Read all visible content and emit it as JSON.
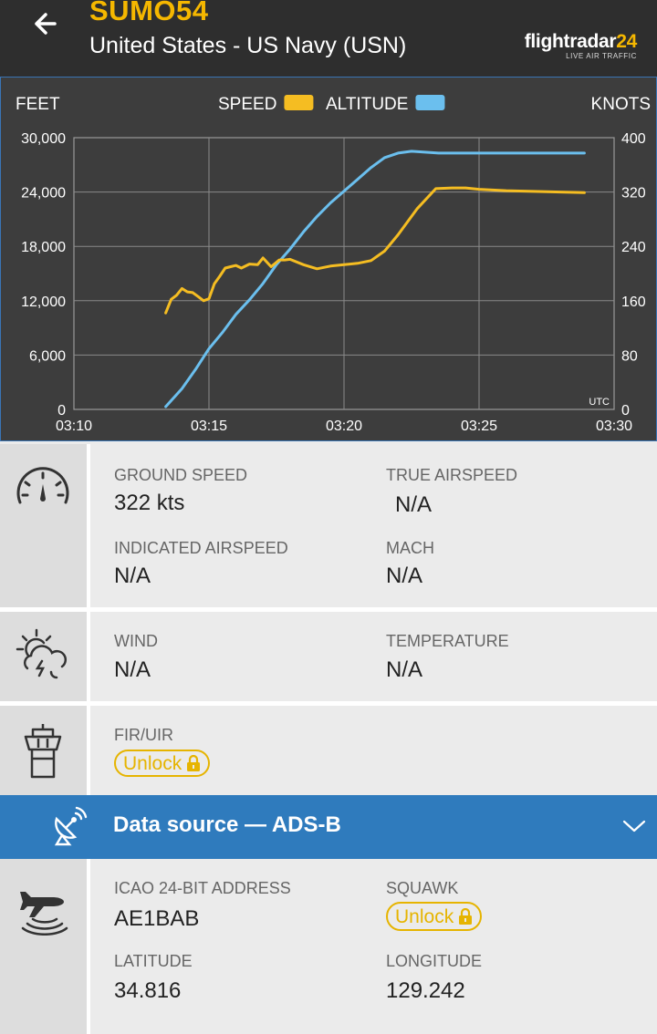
{
  "header": {
    "callsign": "SUMO54",
    "airline": "United States - US Navy (USN)",
    "brand_main": "flightradar",
    "brand_num": "24",
    "brand_tag": "LIVE AIR TRAFFIC"
  },
  "chart_data": {
    "type": "line",
    "left_axis_label": "FEET",
    "right_axis_label": "KNOTS",
    "timezone_label": "UTC",
    "x_ticks": [
      "03:10",
      "03:15",
      "03:20",
      "03:25",
      "03:30"
    ],
    "xlim_minutes": [
      10,
      30
    ],
    "left_ticks": [
      "0",
      "6,000",
      "12,000",
      "18,000",
      "24,000",
      "30,000"
    ],
    "right_ticks": [
      "0",
      "80",
      "160",
      "240",
      "320",
      "400"
    ],
    "ylim_left": [
      0,
      30000
    ],
    "ylim_right": [
      0,
      400
    ],
    "grid": true,
    "legend_position": "top-center",
    "series": [
      {
        "name": "SPEED",
        "axis": "right",
        "color": "#f5bd22",
        "x_minutes": [
          13.4,
          13.6,
          13.8,
          14.0,
          14.2,
          14.4,
          14.6,
          14.8,
          15.0,
          15.2,
          15.4,
          15.6,
          15.8,
          16.0,
          16.2,
          16.5,
          16.8,
          17.0,
          17.3,
          17.6,
          17.8,
          18.0,
          18.5,
          19.0,
          19.5,
          20.0,
          20.5,
          21.0,
          21.5,
          22.0,
          22.7,
          23.4,
          24.0,
          24.5,
          25.0,
          26.0,
          27.0,
          28.0,
          28.9
        ],
        "y_values": [
          142,
          162,
          168,
          178,
          173,
          172,
          166,
          160,
          163,
          185,
          196,
          208,
          210,
          212,
          208,
          214,
          213,
          223,
          210,
          220,
          220,
          221,
          213,
          207,
          211,
          213,
          215,
          219,
          233,
          257,
          295,
          325,
          326,
          326,
          324,
          322,
          321,
          320,
          319
        ]
      },
      {
        "name": "ALTITUDE",
        "axis": "left",
        "color": "#6bbfee",
        "x_minutes": [
          13.4,
          14.0,
          14.5,
          15.0,
          15.5,
          16.0,
          16.5,
          17.0,
          17.5,
          18.0,
          18.5,
          19.0,
          19.5,
          20.0,
          20.5,
          21.0,
          21.5,
          22.0,
          22.5,
          23.0,
          23.5,
          24.0,
          25.0,
          26.0,
          27.0,
          28.0,
          28.9
        ],
        "y_values": [
          300,
          2300,
          4400,
          6700,
          8500,
          10500,
          12100,
          13900,
          16000,
          17700,
          19600,
          21300,
          22800,
          24100,
          25400,
          26700,
          27800,
          28300,
          28500,
          28400,
          28300,
          28300,
          28300,
          28300,
          28300,
          28300,
          28300
        ]
      }
    ]
  },
  "speed_section": {
    "icon": "speedometer-icon",
    "ground_speed_label": "GROUND SPEED",
    "ground_speed_value": "322 kts",
    "true_airspeed_label": "TRUE AIRSPEED",
    "true_airspeed_value": "N/A",
    "indicated_airspeed_label": "INDICATED AIRSPEED",
    "indicated_airspeed_value": "N/A",
    "mach_label": "MACH",
    "mach_value": "N/A"
  },
  "weather_section": {
    "icon": "weather-icon",
    "wind_label": "WIND",
    "wind_value": "N/A",
    "temperature_label": "TEMPERATURE",
    "temperature_value": "N/A"
  },
  "fir_section": {
    "icon": "control-tower-icon",
    "fir_label": "FIR/UIR",
    "unlock_label": "Unlock"
  },
  "data_source": {
    "icon": "satellite-dish-icon",
    "title": "Data source — ADS-B"
  },
  "adsb_section": {
    "icon": "plane-signal-icon",
    "icao_label": "ICAO 24-BIT ADDRESS",
    "icao_value": "AE1BAB",
    "squawk_label": "SQUAWK",
    "squawk_unlock_label": "Unlock",
    "latitude_label": "LATITUDE",
    "latitude_value": "34.816",
    "longitude_label": "LONGITUDE",
    "longitude_value": "129.242"
  },
  "colors": {
    "accent": "#f5b700",
    "header_bg": "#2e2e2e",
    "chart_bg": "#3d3d3d",
    "speed_line": "#f5bd22",
    "altitude_line": "#6bbfee",
    "data_source_bar": "#2f7bbd"
  }
}
